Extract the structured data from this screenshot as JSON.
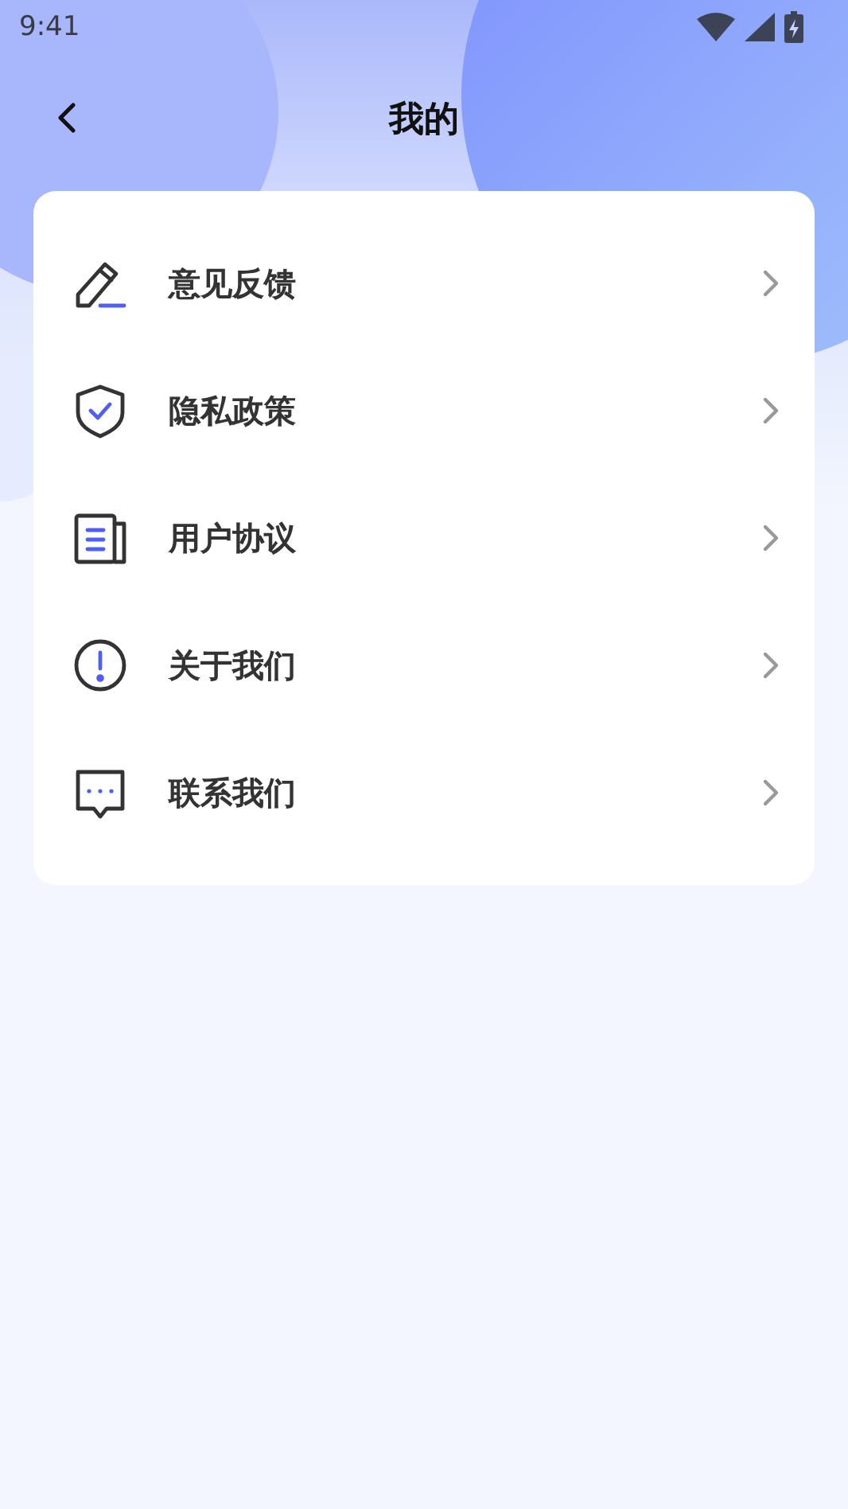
{
  "status_bar": {
    "time": "9:41"
  },
  "header": {
    "title": "我的"
  },
  "menu": [
    {
      "kind": "pencil",
      "label": "意见反馈"
    },
    {
      "kind": "shield",
      "label": "隐私政策"
    },
    {
      "kind": "document",
      "label": "用户协议"
    },
    {
      "kind": "info",
      "label": "关于我们"
    },
    {
      "kind": "chat",
      "label": "联系我们"
    }
  ]
}
